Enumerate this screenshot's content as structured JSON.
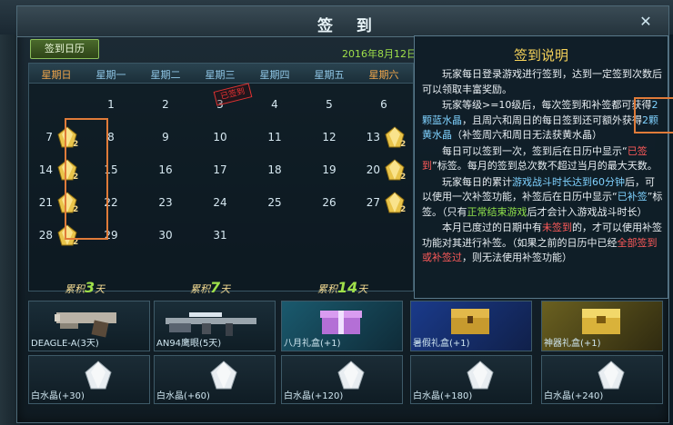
{
  "window": {
    "title": "签 到",
    "close": "✕"
  },
  "tab": {
    "label": "签到日历"
  },
  "current_date": "2016年8月12日",
  "weekdays": [
    "星期日",
    "星期一",
    "星期二",
    "星期三",
    "星期四",
    "星期五",
    "星期六"
  ],
  "calendar": {
    "rows": [
      [
        "",
        "1",
        "2",
        "3",
        "4",
        "5",
        "6"
      ],
      [
        "7",
        "8",
        "9",
        "10",
        "11",
        "12",
        "13"
      ],
      [
        "14",
        "15",
        "16",
        "17",
        "18",
        "19",
        "20"
      ],
      [
        "21",
        "22",
        "23",
        "24",
        "25",
        "26",
        "27"
      ],
      [
        "28",
        "29",
        "30",
        "31",
        "",
        "",
        ""
      ]
    ],
    "reward_count": "2",
    "stamp_text": "已签到"
  },
  "info": {
    "title": "签到说明",
    "p1": "玩家每日登录游戏进行签到，达到一定签到次数后可以领取丰富奖励。",
    "p2a": "玩家等级>=10级后，每次签到和补签都可获得",
    "p2b": "2颗蓝水晶",
    "p2c": "，且周六和周日的每日签到还可额外获得",
    "p2d": "2颗黄水晶",
    "p2e": "（补签周六和周日无法获黄水晶）",
    "p3a": "每日可以签到一次，签到后在日历中显示“",
    "p3b": "已签到",
    "p3c": "”标签。每月的签到总次数不超过当月的最大天数。",
    "p4a": "玩家每日的累计",
    "p4b": "游戏战斗时长达到60分钟",
    "p4c": "后，可以使用一次补签功能，补签后在日历中显示“",
    "p4d": "已补签",
    "p4e": "”标签。（只有",
    "p4f": "正常结束游戏",
    "p4g": "后才会计入游戏战斗时长）",
    "p5a": "本月已度过的日期中有",
    "p5b": "未签到",
    "p5c": "的，才可以使用补签功能对其进行补签。（如果之前的日历中已经",
    "p5d": "全部签到或补签过",
    "p5e": "，则无法使用补签功能）"
  },
  "accum": [
    {
      "prefix": "累积",
      "value": "3",
      "suffix": "天"
    },
    {
      "prefix": "累积",
      "value": "7",
      "suffix": "天"
    },
    {
      "prefix": "累积",
      "value": "14",
      "suffix": "天"
    }
  ],
  "rewards": [
    {
      "label": "DEAGLE-A(3天)",
      "icon": "pistol-icon"
    },
    {
      "label": "AN94鹰眼(5天)",
      "icon": "rifle-icon"
    },
    {
      "label": "八月礼盒(+1)",
      "icon": "gift-box-icon"
    },
    {
      "label": "暑假礼盒(+1)",
      "icon": "treasure-chest-icon"
    },
    {
      "label": "神器礼盒(+1)",
      "icon": "golden-chest-icon"
    }
  ],
  "crystals": [
    {
      "label": "白水晶(+30)"
    },
    {
      "label": "白水晶(+60)"
    },
    {
      "label": "白水晶(+120)"
    },
    {
      "label": "白水晶(+180)"
    },
    {
      "label": "白水晶(+240)"
    }
  ],
  "colors": {
    "accent_green": "#9fe04a",
    "highlight_orange": "#e07b39",
    "weekend": "#f0a64a",
    "info_title": "#f6d35a"
  }
}
